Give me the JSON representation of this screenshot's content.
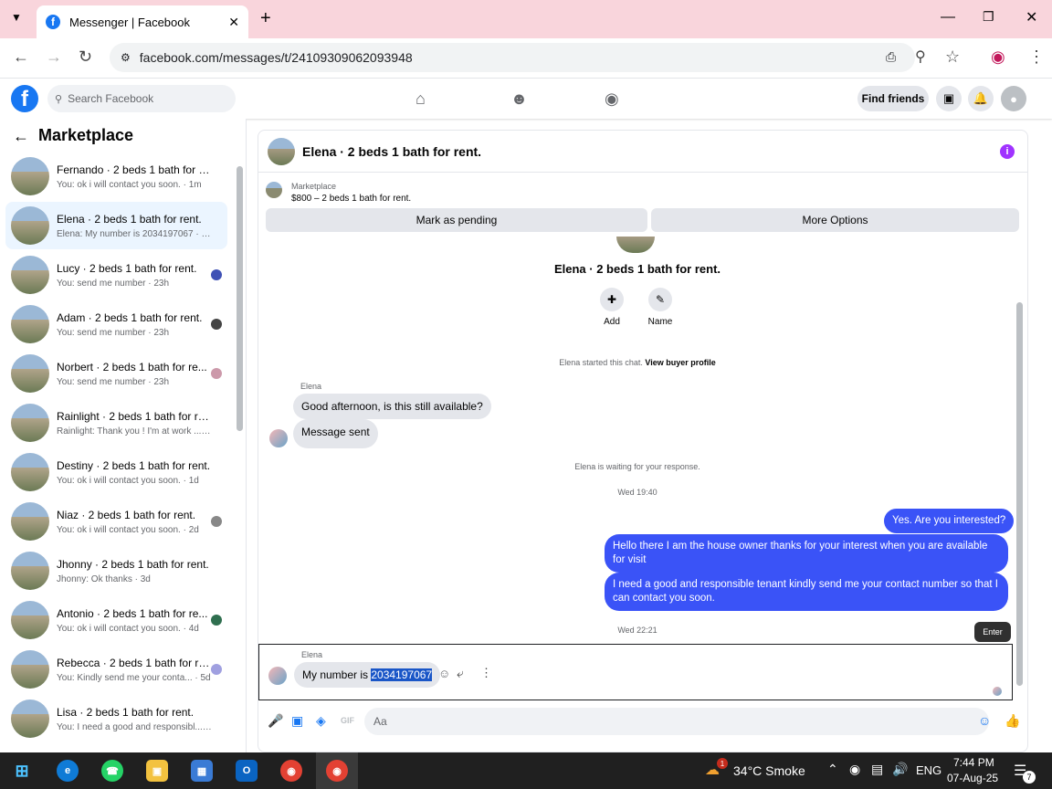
{
  "browser": {
    "tab_title": "Messenger | Facebook",
    "url": "facebook.com/messages/t/24109309062093948"
  },
  "header": {
    "search_placeholder": "Search Facebook",
    "find_friends": "Find friends"
  },
  "sidebar": {
    "title": "Marketplace",
    "conversations": [
      {
        "name": "Fernando · 2 beds 1 bath for rent.",
        "preview": "You: ok i will contact you soon. · 1m",
        "active": false
      },
      {
        "name": "Elena · 2 beds 1 bath for rent.",
        "preview": "Elena: My number is 2034197067 · 21h",
        "active": true
      },
      {
        "name": "Lucy · 2 beds 1 bath for rent.",
        "preview": "You: send me number · 23h",
        "active": false
      },
      {
        "name": "Adam · 2 beds 1 bath for rent.",
        "preview": "You: send me number · 23h",
        "active": false
      },
      {
        "name": "Norbert · 2 beds 1 bath for re...",
        "preview": "You: send me number · 23h",
        "active": false
      },
      {
        "name": "Rainlight · 2 beds 1 bath for rent.",
        "preview": "Rainlight: Thank you ! I'm at work ... · 1d",
        "active": false
      },
      {
        "name": "Destiny · 2 beds 1 bath for rent.",
        "preview": "You: ok i will contact you soon. · 1d",
        "active": false
      },
      {
        "name": "Niaz · 2 beds 1 bath for rent.",
        "preview": "You: ok i will contact you soon. · 2d",
        "active": false
      },
      {
        "name": "Jhonny · 2 beds 1 bath for rent.",
        "preview": "Jhonny: Ok thanks · 3d",
        "active": false
      },
      {
        "name": "Antonio · 2 beds 1 bath for re...",
        "preview": "You: ok i will contact you soon. · 4d",
        "active": false
      },
      {
        "name": "Rebecca · 2 beds 1 bath for re...",
        "preview": "You: Kindly send me your conta... · 5d",
        "active": false
      },
      {
        "name": "Lisa · 2 beds 1 bath for rent.",
        "preview": "You: I need a good and responsibl... · 6d",
        "active": false
      }
    ]
  },
  "chat": {
    "title": "Elena · 2 beds 1 bath for rent.",
    "marketplace_label": "Marketplace",
    "listing": "$800 – 2 beds 1 bath for rent.",
    "mark_pending": "Mark as pending",
    "more_options": "More Options",
    "profile_name": "Elena · 2 beds 1 bath for rent.",
    "add_label": "Add",
    "name_label": "Name",
    "started_text": "Elena started this chat.",
    "view_profile": "View buyer profile",
    "sender_name": "Elena",
    "msg_in_1": "Good afternoon, is this still available?",
    "msg_in_2": "Message sent",
    "waiting": "Elena is waiting for your response.",
    "time_1": "Wed 19:40",
    "msg_out_1": "Yes. Are you interested?",
    "msg_out_2": "Hello there I am the house owner thanks for your interest when you are available for visit",
    "msg_out_3": "I need a good and responsible tenant kindly send me your contact number so that I can contact you soon.",
    "time_2": "Wed 22:21",
    "enter_tooltip": "Enter",
    "reply_sender": "Elena",
    "reply_prefix": "My number is ",
    "reply_number": "2034197067",
    "composer_placeholder": "Aa"
  },
  "taskbar": {
    "weather": "34°C  Smoke",
    "lang": "ENG",
    "time": "7:44 PM",
    "date": "07-Aug-25",
    "notif_count": "7",
    "weather_badge": "1"
  },
  "colors": {
    "fb_blue": "#1877f2",
    "outgoing_bubble": "#3a53f7",
    "active_conv": "#ebf5ff",
    "tab_bar": "#f9d5dc"
  }
}
